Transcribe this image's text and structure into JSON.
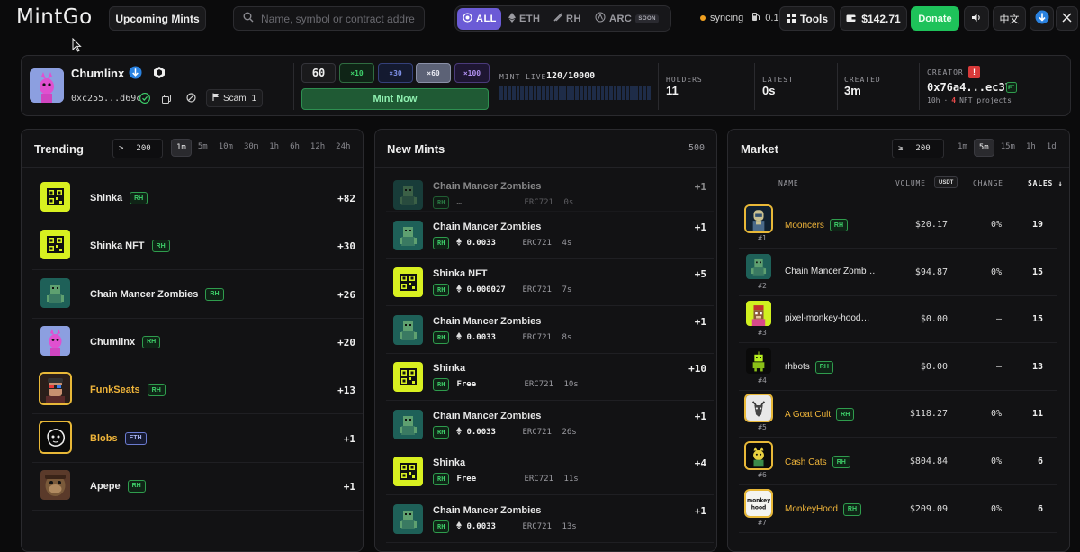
{
  "topbar": {
    "logo": "MintGo",
    "upcoming_label": "Upcoming Mints",
    "search_placeholder": "Name, symbol or contract addre",
    "chains": [
      {
        "label": "ALL",
        "icon": "all-chains-icon"
      },
      {
        "label": "ETH",
        "icon": "eth-icon"
      },
      {
        "label": "RH",
        "icon": "rh-icon"
      },
      {
        "label": "ARC",
        "icon": "arc-icon",
        "badge": "SOON"
      }
    ],
    "status": "syncing",
    "gas": "0.1",
    "tools_label": "Tools",
    "balance": "$142.71",
    "donate_label": "Donate",
    "lang": "中文"
  },
  "collection": {
    "name": "Chumlinx",
    "address": "0xc255...d69c",
    "scam_label": "Scam",
    "scam_count": "1",
    "quantity": "60",
    "multipliers": [
      "×10",
      "×30",
      "×60",
      "×100"
    ],
    "mint_label": "Mint Now",
    "mint_live_label": "MINT LIVE",
    "mint_live_value": "120/10000",
    "mint_progress_fraction": 0.012,
    "holders_label": "HOLDERS",
    "holders_value": "11",
    "latest_label": "LATEST",
    "latest_value": "0s",
    "created_label": "CREATED",
    "created_value": "3m",
    "creator_label": "CREATOR",
    "creator_flag": "!",
    "creator_address": "0x76a4...ec37",
    "creator_age": "10h",
    "creator_sep": "·",
    "creator_projects_count": "4",
    "creator_projects_label": "NFT projects"
  },
  "trending": {
    "title": "Trending",
    "filter_op": ">",
    "filter_value": "200",
    "timeframes": [
      "1m",
      "5m",
      "10m",
      "30m",
      "1h",
      "6h",
      "12h",
      "24h"
    ],
    "active_timeframe": "1m",
    "items": [
      {
        "name": "Shinka",
        "chain": "RH",
        "count": "+82",
        "thumb": "qr",
        "gold": false
      },
      {
        "name": "Shinka NFT",
        "chain": "RH",
        "count": "+30",
        "thumb": "qr",
        "gold": false
      },
      {
        "name": "Chain Mancer Zombies",
        "chain": "RH",
        "count": "+26",
        "thumb": "zombie",
        "gold": false
      },
      {
        "name": "Chumlinx",
        "chain": "RH",
        "count": "+20",
        "thumb": "chumlinx",
        "gold": false
      },
      {
        "name": "FunkSeats",
        "chain": "RH",
        "count": "+13",
        "thumb": "funk",
        "gold": true
      },
      {
        "name": "Blobs",
        "chain": "ETH",
        "count": "+1",
        "thumb": "blob",
        "gold": true
      },
      {
        "name": "Apepe",
        "chain": "RH",
        "count": "+1",
        "thumb": "apepe",
        "gold": false
      }
    ]
  },
  "new_mints": {
    "title": "New Mints",
    "count": "500",
    "items": [
      {
        "name": "Chain Mancer Zombies",
        "chain": "RH",
        "price": "…",
        "std": "ERC721",
        "age": "0s",
        "count": "+1",
        "thumb": "zombie",
        "faded": true,
        "show_eth": false
      },
      {
        "name": "Chain Mancer Zombies",
        "chain": "RH",
        "price": "0.0033",
        "std": "ERC721",
        "age": "4s",
        "count": "+1",
        "thumb": "zombie",
        "faded": false,
        "show_eth": true
      },
      {
        "name": "Shinka NFT",
        "chain": "RH",
        "price": "0.000027",
        "std": "ERC721",
        "age": "7s",
        "count": "+5",
        "thumb": "qr",
        "faded": false,
        "show_eth": true
      },
      {
        "name": "Chain Mancer Zombies",
        "chain": "RH",
        "price": "0.0033",
        "std": "ERC721",
        "age": "8s",
        "count": "+1",
        "thumb": "zombie",
        "faded": false,
        "show_eth": true
      },
      {
        "name": "Shinka",
        "chain": "RH",
        "price": "Free",
        "std": "ERC721",
        "age": "10s",
        "count": "+10",
        "thumb": "qr",
        "faded": false,
        "show_eth": false
      },
      {
        "name": "Chain Mancer Zombies",
        "chain": "RH",
        "price": "0.0033",
        "std": "ERC721",
        "age": "26s",
        "count": "+1",
        "thumb": "zombie",
        "faded": false,
        "show_eth": true
      },
      {
        "name": "Shinka",
        "chain": "RH",
        "price": "Free",
        "std": "ERC721",
        "age": "11s",
        "count": "+4",
        "thumb": "qr",
        "faded": false,
        "show_eth": false
      },
      {
        "name": "Chain Mancer Zombies",
        "chain": "RH",
        "price": "0.0033",
        "std": "ERC721",
        "age": "13s",
        "count": "+1",
        "thumb": "zombie",
        "faded": false,
        "show_eth": true
      }
    ]
  },
  "market": {
    "title": "Market",
    "filter_op": "≥",
    "filter_value": "200",
    "timeframes": [
      "1m",
      "5m",
      "15m",
      "1h",
      "1d"
    ],
    "active_timeframe": "5m",
    "col_name": "NAME",
    "col_volume": "VOLUME",
    "col_volume_unit": "USDT",
    "col_change": "CHANGE",
    "col_sales": "SALES ↓",
    "items": [
      {
        "rank": "#1",
        "name": "Mooncers",
        "chain": "RH",
        "volume": "$20.17",
        "change": "0%",
        "sales": "19",
        "thumb": "moon",
        "gold": true
      },
      {
        "rank": "#2",
        "name": "Chain Mancer Zomb…",
        "chain": "",
        "volume": "$94.87",
        "change": "0%",
        "sales": "15",
        "thumb": "zombie",
        "gold": false
      },
      {
        "rank": "#3",
        "name": "pixel-monkey-hood…",
        "chain": "",
        "volume": "$0.00",
        "change": "—",
        "sales": "15",
        "thumb": "monkeypx",
        "gold": false
      },
      {
        "rank": "#4",
        "name": "rhbots",
        "chain": "RH",
        "volume": "$0.00",
        "change": "—",
        "sales": "13",
        "thumb": "bot",
        "gold": false
      },
      {
        "rank": "#5",
        "name": "A Goat Cult",
        "chain": "RH",
        "volume": "$118.27",
        "change": "0%",
        "sales": "11",
        "thumb": "goat",
        "gold": true
      },
      {
        "rank": "#6",
        "name": "Cash Cats",
        "chain": "RH",
        "volume": "$804.84",
        "change": "0%",
        "sales": "6",
        "thumb": "cat",
        "gold": true
      },
      {
        "rank": "#7",
        "name": "MonkeyHood",
        "chain": "RH",
        "volume": "$209.09",
        "change": "0%",
        "sales": "6",
        "thumb": "monkeyhood",
        "gold": true
      }
    ]
  },
  "colors": {
    "accent": "#6b5bd6",
    "green": "#1ec25a",
    "gold": "#f0b53a",
    "rh": "#3ed06a"
  }
}
